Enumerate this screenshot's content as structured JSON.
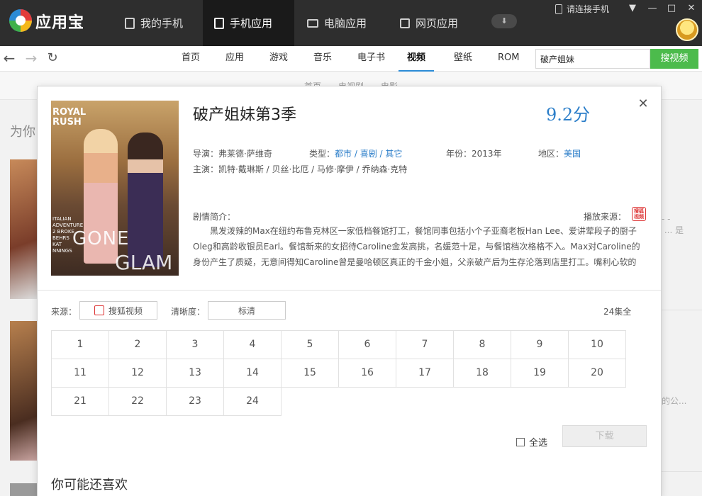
{
  "titlebar": {
    "app_name": "应用宝",
    "tabs": [
      {
        "label": "我的手机",
        "active": false
      },
      {
        "label": "手机应用",
        "active": true
      },
      {
        "label": "电脑应用",
        "active": false
      },
      {
        "label": "网页应用",
        "active": false
      }
    ],
    "connect_phone": "请连接手机",
    "window_controls": [
      "menu-icon",
      "minimize-icon",
      "maximize-icon",
      "close-icon"
    ]
  },
  "navbar": {
    "categories": [
      {
        "label": "首页",
        "active": false
      },
      {
        "label": "应用",
        "active": false
      },
      {
        "label": "游戏",
        "active": false
      },
      {
        "label": "音乐",
        "active": false
      },
      {
        "label": "电子书",
        "active": false
      },
      {
        "label": "视频",
        "active": true
      },
      {
        "label": "壁纸",
        "active": false
      },
      {
        "label": "ROM",
        "active": false
      }
    ],
    "search_value": "破产姐妹",
    "search_button": "搜视频"
  },
  "background": {
    "subnav": [
      "首页",
      "电视剧",
      "电影"
    ],
    "section_title": "为你",
    "side_text_1": "- -\n ... 是",
    "side_text_2": "的公..."
  },
  "dialog": {
    "title": "破产姐妹第3季",
    "score": "9.2分",
    "poster_text": {
      "top": "ROYAL\nRUSH",
      "small": "ITALIAN\nADVENTURE\n2 BROKE\nBEHRS\nKAT\nNNINGS",
      "gone": "GONE",
      "glam": "GLAM"
    },
    "director_label": "导演：",
    "director": "弗莱德·萨维奇",
    "genre_label": "类型：",
    "genre": "都市 / 喜剧 / 其它",
    "year_label": "年份：",
    "year": "2013年",
    "region_label": "地区：",
    "region": "美国",
    "cast_label": "主演：",
    "cast": "凯特·戴琳斯 / 贝丝·比厄 / 马修·摩伊 / 乔纳森·克特",
    "synopsis_label": "剧情简介：",
    "source_label": "播放来源：",
    "source_icon_text": "搜狐\n视频",
    "synopsis": "黑发泼辣的Max在纽约布鲁克林区一家低档餐馆打工，餐馆同事包括小个子亚裔老板Han Lee、爱讲荤段子的厨子Oleg和高龄收银员Earl。餐馆新来的女招待Caroline金发高挑，名媛范十足，与餐馆档次格格不入。Max对Caroline的身份产生了质疑，无意间得知Caroline曾是曼哈顿区真正的千金小姐，父亲破产后为生存沦落到店里打工。嘴利心软的M...",
    "from_label": "来源：",
    "from_value": "搜狐视频",
    "quality_label": "清晰度：",
    "quality_value": "标清",
    "episode_count": "24集全",
    "episodes": [
      "1",
      "2",
      "3",
      "4",
      "5",
      "6",
      "7",
      "8",
      "9",
      "10",
      "11",
      "12",
      "13",
      "14",
      "15",
      "16",
      "17",
      "18",
      "19",
      "20",
      "21",
      "22",
      "23",
      "24"
    ],
    "select_all": "全选",
    "download": "下载",
    "also_like": "你可能还喜欢"
  }
}
